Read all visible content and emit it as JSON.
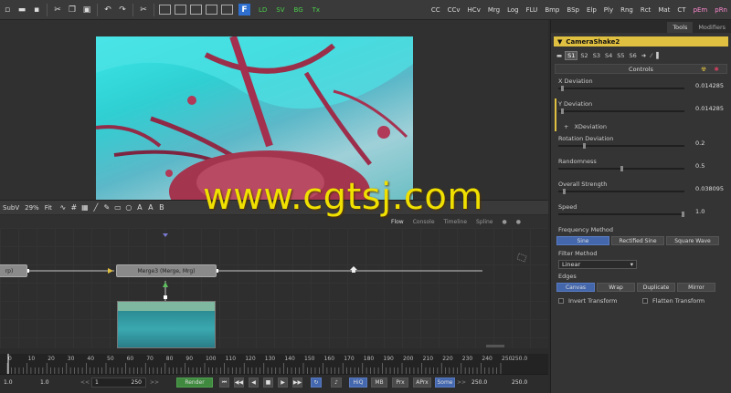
{
  "toolbar": {
    "view_buttons": [
      "LD",
      "SV",
      "BG",
      "Tx"
    ],
    "tools": [
      "CC",
      "CCv",
      "HCv",
      "Mrg",
      "Log",
      "FLU",
      "Bmp",
      "BSp",
      "Elp",
      "Ply",
      "Rng",
      "Rct",
      "Mat",
      "CT",
      "pEm",
      "pRn"
    ]
  },
  "viewer_bar": {
    "channel": "SubV",
    "zoom": "29%",
    "fit": "Fit"
  },
  "flow_tabs": [
    "Flow",
    "Console",
    "Timeline",
    "Spline"
  ],
  "nodes": {
    "left_partial": "rp)",
    "merge": "Merge3 (Merge, Mrg)"
  },
  "timeline": {
    "ticks": [
      "0",
      "10",
      "20",
      "30",
      "40",
      "50",
      "60",
      "70",
      "80",
      "90",
      "100",
      "110",
      "120",
      "130",
      "140",
      "150",
      "160",
      "170",
      "180",
      "190",
      "200",
      "210",
      "220",
      "230",
      "240",
      "250"
    ],
    "end": "250.0"
  },
  "transport": {
    "global_start": "1.0",
    "render_start": "1.0",
    "current": "1",
    "render_end": "250",
    "render_label": "Render",
    "hiq": "HiQ",
    "mb": "MB",
    "prx": "Prx",
    "aprx": "APrx",
    "some": "Some",
    "render_end_field": "250.0",
    "global_end": "250.0"
  },
  "panel": {
    "tabs": [
      "Tools",
      "Modifiers"
    ],
    "tool_name": "CameraShake2",
    "slots": [
      "S1",
      "S2",
      "S3",
      "S4",
      "S5",
      "S6"
    ],
    "controls_tab": "Controls",
    "controls": [
      {
        "label": "X Deviation",
        "value": "0.014285",
        "fraction": 0.02
      },
      {
        "label": "Y Deviation",
        "value": "0.014285",
        "fraction": 0.02
      },
      {
        "label": "Rotation Deviation",
        "value": "0.2",
        "fraction": 0.2
      },
      {
        "label": "Randomness",
        "value": "0.5",
        "fraction": 0.5
      },
      {
        "label": "Overall Strength",
        "value": "0.038095",
        "fraction": 0.04
      },
      {
        "label": "Speed",
        "value": "1.0",
        "fraction": 1.0
      }
    ],
    "xdeviation_link": "XDeviation",
    "frequency_label": "Frequency Method",
    "frequency_options": [
      "Sine",
      "Rectified Sine",
      "Square Wave"
    ],
    "filter_label": "Filter Method",
    "filter_value": "Linear",
    "edges_label": "Edges",
    "edges_options": [
      "Canvas",
      "Wrap",
      "Duplicate",
      "Mirror"
    ],
    "invert_label": "Invert Transform",
    "flatten_label": "Flatten Transform"
  },
  "watermark": "www.cgtsj.com"
}
